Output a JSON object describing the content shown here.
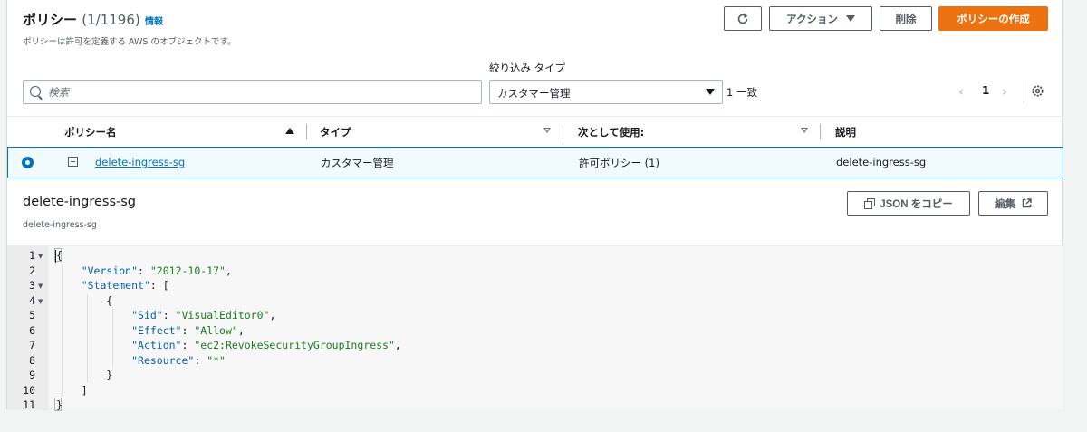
{
  "header": {
    "title": "ポリシー",
    "count": "(1/1196)",
    "info_label": "情報",
    "subtitle": "ポリシーは許可を定義する AWS のオブジェクトです。"
  },
  "actions": {
    "refresh_icon": "refresh-icon",
    "actions_label": "アクション",
    "delete_label": "削除",
    "create_label": "ポリシーの作成"
  },
  "filter": {
    "type_label": "絞り込み タイプ",
    "search_placeholder": "検索",
    "search_value": "",
    "type_selected": "カスタマー管理",
    "match_count": "1 一致"
  },
  "pagination": {
    "prev": "‹",
    "current_page": "1",
    "next": "›"
  },
  "table": {
    "columns": [
      "ポリシー名",
      "タイプ",
      "次として使用:",
      "説明"
    ],
    "rows": [
      {
        "selected": true,
        "name": "delete-ingress-sg",
        "type": "カスタマー管理",
        "used_as": "許可ポリシー (1)",
        "description": "delete-ingress-sg"
      }
    ]
  },
  "detail": {
    "title": "delete-ingress-sg",
    "subtitle": "delete-ingress-sg",
    "copy_json_label": "JSON をコピー",
    "edit_label": "編集"
  },
  "code": {
    "line_numbers": [
      "1",
      "2",
      "3",
      "4",
      "5",
      "6",
      "7",
      "8",
      "9",
      "10",
      "11"
    ],
    "lines": [
      "{",
      "    \"Version\": \"2012-10-17\",",
      "    \"Statement\": [",
      "        {",
      "            \"Sid\": \"VisualEditor0\",",
      "            \"Effect\": \"Allow\",",
      "            \"Action\": \"ec2:RevokeSecurityGroupIngress\",",
      "            \"Resource\": \"*\"",
      "        }",
      "    ]",
      "}"
    ]
  },
  "colors": {
    "primary": "#ec7211",
    "link": "#0073bb",
    "selected_row_bg": "#f1faff",
    "json_key": "#0b5ea8",
    "json_string": "#1a7a21"
  }
}
